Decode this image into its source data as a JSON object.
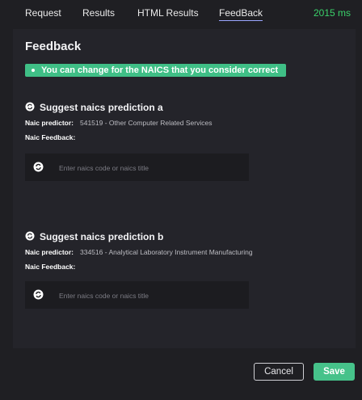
{
  "tabs": [
    {
      "label": "Request"
    },
    {
      "label": "Results"
    },
    {
      "label": "HTML Results"
    },
    {
      "label": "FeedBack"
    }
  ],
  "timing": "2015 ms",
  "feedback": {
    "heading": "Feedback",
    "notice": "You can change for the NAICS that you consider correct",
    "sections": [
      {
        "title": "Suggest naics prediction a",
        "predictor_label": "Naic predictor:",
        "predictor_value": "541519 - Other Computer Related Services",
        "feedback_label": "Naic Feedback:",
        "input_placeholder": "Enter naics code or naics title",
        "input_value": ""
      },
      {
        "title": "Suggest naics prediction b",
        "predictor_label": "Naic predictor:",
        "predictor_value": "334516 - Analytical Laboratory Instrument Manufacturing",
        "feedback_label": "Naic Feedback:",
        "input_placeholder": "Enter naics code or naics title",
        "input_value": ""
      }
    ]
  },
  "actions": {
    "cancel_label": "Cancel",
    "save_label": "Save"
  },
  "colors": {
    "accent": "#3fbf86",
    "timing": "#3ad16a",
    "background": "#1f1f23"
  },
  "icons": {
    "section": "refresh-circle-icon",
    "input": "refresh-circle-icon",
    "notice": "bullet-dot-icon"
  }
}
